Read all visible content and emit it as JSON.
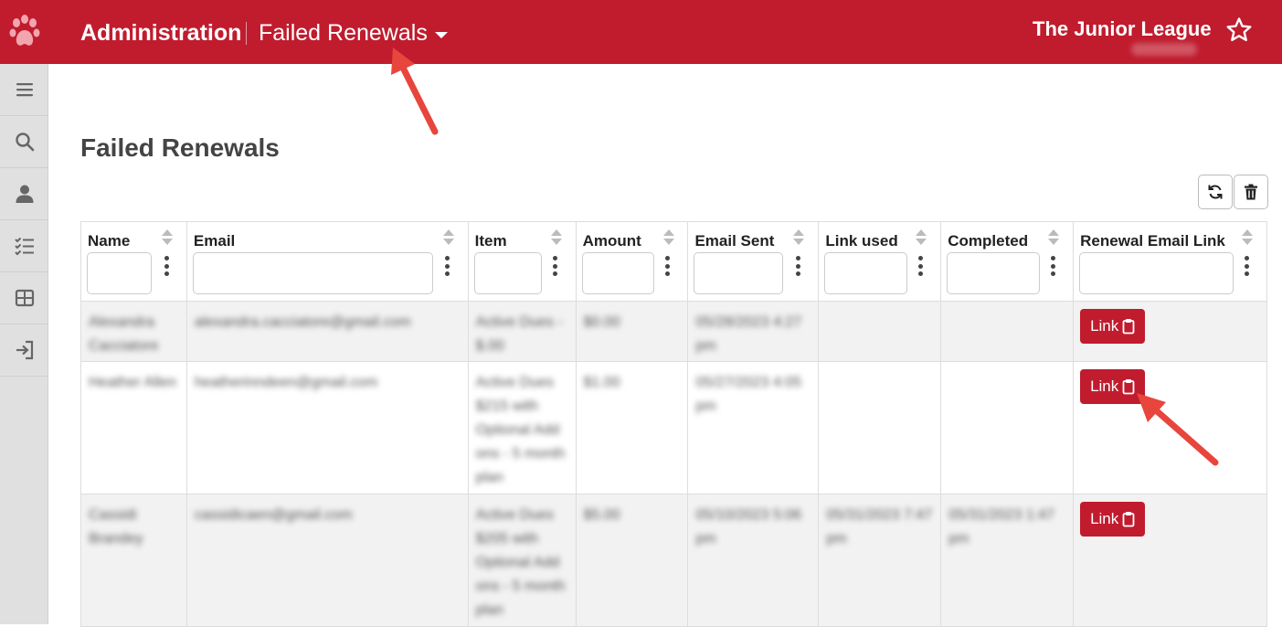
{
  "header": {
    "app_title": "Administration",
    "section": "Failed Renewals",
    "org_name": "The Junior League",
    "org_subtitle": "Kings P*"
  },
  "sidebar": {
    "items": [
      {
        "icon": "menu-icon"
      },
      {
        "icon": "search-icon"
      },
      {
        "icon": "user-icon"
      },
      {
        "icon": "checklist-icon"
      },
      {
        "icon": "table-icon"
      },
      {
        "icon": "sign-out-icon"
      }
    ]
  },
  "page": {
    "title": "Failed Renewals"
  },
  "toolbar": {
    "refresh_icon": "refresh-icon",
    "delete_icon": "trash-icon"
  },
  "table": {
    "columns": [
      "Name",
      "Email",
      "Item",
      "Amount",
      "Email Sent",
      "Link used",
      "Completed",
      "Renewal Email Link"
    ],
    "link_label": "Link",
    "rows": [
      {
        "name": "Alexandra Cacciatore",
        "email": "alexandra.cacciatore@gmail.com",
        "item": "Active Dues - $.00",
        "amount": "$0.00",
        "email_sent": "05/28/2023 4:27 pm",
        "link_used": "",
        "completed": ""
      },
      {
        "name": "Heather Allen",
        "email": "heatherinndeen@gmail.com",
        "item": "Active Dues $215 with Optional Add ons - 5 month plan",
        "amount": "$1.00",
        "email_sent": "05/27/2023 4:05 pm",
        "link_used": "",
        "completed": ""
      },
      {
        "name": "Cassidi Brandey",
        "email": "cassidicaen@gmail.com",
        "item": "Active Dues $205 with Optional Add ons - 5 month plan",
        "amount": "$5.00",
        "email_sent": "05/10/2023 5:06 pm",
        "link_used": "05/31/2023 7:47 pm",
        "completed": "05/31/2023 1:47 pm"
      }
    ]
  },
  "colors": {
    "brand_red": "#c01c2e",
    "annotation_arrow": "#e8453c"
  }
}
